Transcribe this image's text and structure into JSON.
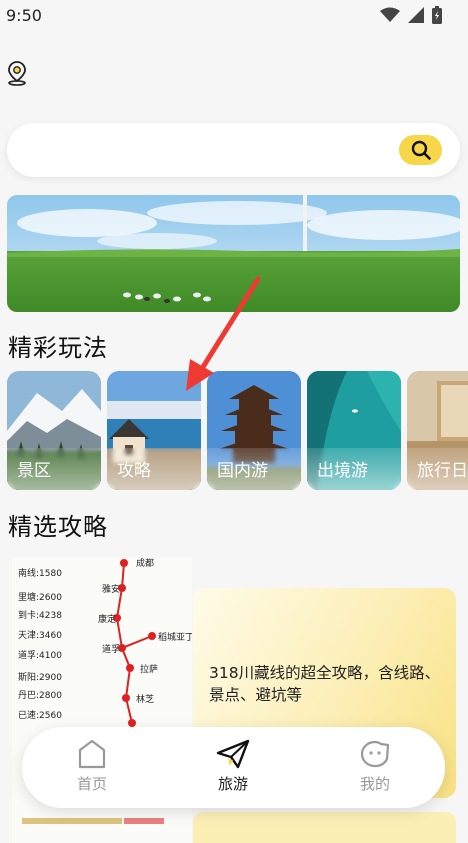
{
  "status_bar": {
    "time": "9:50"
  },
  "search": {
    "placeholder": ""
  },
  "sections": {
    "play_title": "精彩玩法",
    "guide_title": "精选攻略"
  },
  "play_cards": [
    {
      "label": "景区"
    },
    {
      "label": "攻略"
    },
    {
      "label": "国内游"
    },
    {
      "label": "出境游"
    },
    {
      "label": "旅行日"
    }
  ],
  "guide": {
    "title": "318川藏线的超全攻略，含线路、景点、避坑等",
    "map_labels": {
      "left_column": [
        "南线:1580",
        "里塘:2600",
        "到卡:4238",
        "天津:3460",
        "道孚:4100",
        "斯阳:2900",
        "丹巴:2800",
        "已速:2560"
      ],
      "route_labels": [
        "成都",
        "雅安",
        "康定",
        "道孚",
        "拉萨",
        "林芝",
        "稻城亚丁"
      ]
    }
  },
  "nav": [
    {
      "label": "首页",
      "icon": "home-icon"
    },
    {
      "label": "旅游",
      "icon": "paper-plane-icon"
    },
    {
      "label": "我的",
      "icon": "face-icon"
    }
  ],
  "colors": {
    "accent": "#f8d64a",
    "arrow": "#ee3a32"
  }
}
